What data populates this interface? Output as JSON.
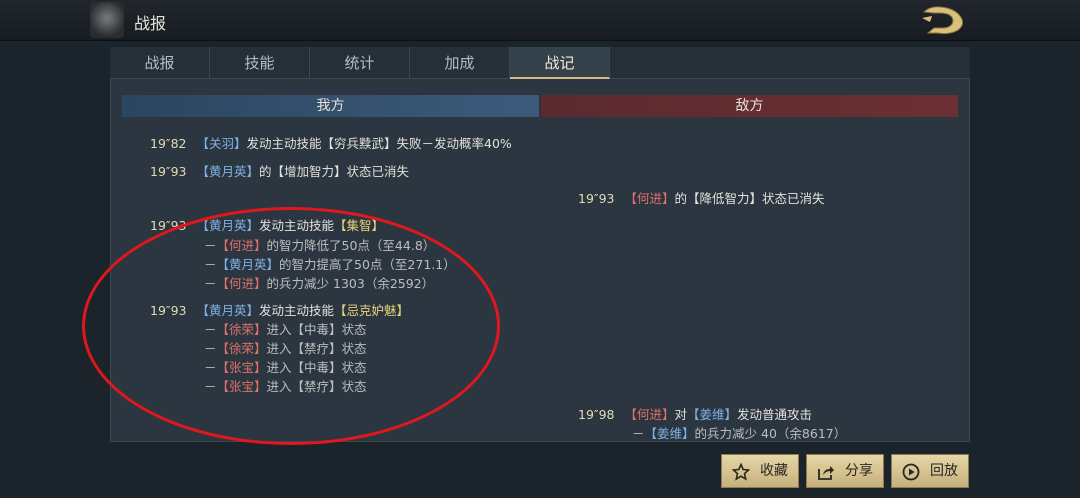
{
  "header": {
    "title": "战报"
  },
  "tabs": [
    {
      "label": "战报"
    },
    {
      "label": "技能"
    },
    {
      "label": "统计"
    },
    {
      "label": "加成"
    },
    {
      "label": "战记",
      "active": true
    }
  ],
  "columns": {
    "left": "我方",
    "right": "敌方"
  },
  "left_logs": [
    {
      "time": "19″82",
      "segments": [
        {
          "t": "【关羽】",
          "c": "blue"
        },
        {
          "t": "发动主动技能【穷兵黩武】失败－发动概率40%",
          "c": ""
        }
      ]
    },
    {
      "time": "19″93",
      "segments": [
        {
          "t": "【黄月英】",
          "c": "blue"
        },
        {
          "t": "的【增加智力】状态已消失",
          "c": ""
        }
      ]
    },
    {
      "time": "19″93",
      "segments": [
        {
          "t": "【黄月英】",
          "c": "blue"
        },
        {
          "t": "发动主动技能",
          "c": ""
        },
        {
          "t": "【集智】",
          "c": "yel"
        }
      ]
    },
    {
      "time": "",
      "segments": [
        {
          "t": "－",
          "c": "sub"
        },
        {
          "t": "【何进】",
          "c": "red"
        },
        {
          "t": "的智力降低了50点（至44.8）",
          "c": "sub"
        }
      ]
    },
    {
      "time": "",
      "segments": [
        {
          "t": "－",
          "c": "sub"
        },
        {
          "t": "【黄月英】",
          "c": "blue"
        },
        {
          "t": "的智力提高了50点（至271.1）",
          "c": "sub"
        }
      ]
    },
    {
      "time": "",
      "segments": [
        {
          "t": "－",
          "c": "sub"
        },
        {
          "t": "【何进】",
          "c": "red"
        },
        {
          "t": "的兵力减少 1303（余2592）",
          "c": "sub"
        }
      ]
    },
    {
      "time": "19″93",
      "segments": [
        {
          "t": "【黄月英】",
          "c": "blue"
        },
        {
          "t": "发动主动技能",
          "c": ""
        },
        {
          "t": "【忌克妒魅】",
          "c": "yel"
        }
      ]
    },
    {
      "time": "",
      "segments": [
        {
          "t": "－",
          "c": "sub"
        },
        {
          "t": "【徐荣】",
          "c": "red"
        },
        {
          "t": "进入【中毒】状态",
          "c": "sub"
        }
      ]
    },
    {
      "time": "",
      "segments": [
        {
          "t": "－",
          "c": "sub"
        },
        {
          "t": "【徐荣】",
          "c": "red"
        },
        {
          "t": "进入【禁疗】状态",
          "c": "sub"
        }
      ]
    },
    {
      "time": "",
      "segments": [
        {
          "t": "－",
          "c": "sub"
        },
        {
          "t": "【张宝】",
          "c": "red"
        },
        {
          "t": "进入【中毒】状态",
          "c": "sub"
        }
      ]
    },
    {
      "time": "",
      "segments": [
        {
          "t": "－",
          "c": "sub"
        },
        {
          "t": "【张宝】",
          "c": "red"
        },
        {
          "t": "进入【禁疗】状态",
          "c": "sub"
        }
      ]
    }
  ],
  "right_logs": [
    {
      "time": "19″93",
      "segments": [
        {
          "t": "【何进】",
          "c": "red"
        },
        {
          "t": "的【降低智力】状态已消失",
          "c": ""
        }
      ]
    },
    {
      "time": "19″98",
      "segments": [
        {
          "t": "【何进】",
          "c": "red"
        },
        {
          "t": "对",
          "c": ""
        },
        {
          "t": "【姜维】",
          "c": "blue"
        },
        {
          "t": "发动普通攻击",
          "c": ""
        }
      ]
    },
    {
      "time": "",
      "segments": [
        {
          "t": "－",
          "c": "sub"
        },
        {
          "t": "【姜维】",
          "c": "blue"
        },
        {
          "t": "的兵力减少 40（余8617）",
          "c": "sub"
        }
      ]
    }
  ],
  "buttons": {
    "favorite": "收藏",
    "share": "分享",
    "replay": "回放"
  },
  "icons": {
    "favorite": "star-icon",
    "share": "share-icon",
    "replay": "play-icon"
  },
  "colors": {
    "ally_blue": "#7fb1e6",
    "enemy_red": "#e0706a",
    "skill_yellow": "#e7d27a",
    "annotation": "#e0171d"
  }
}
